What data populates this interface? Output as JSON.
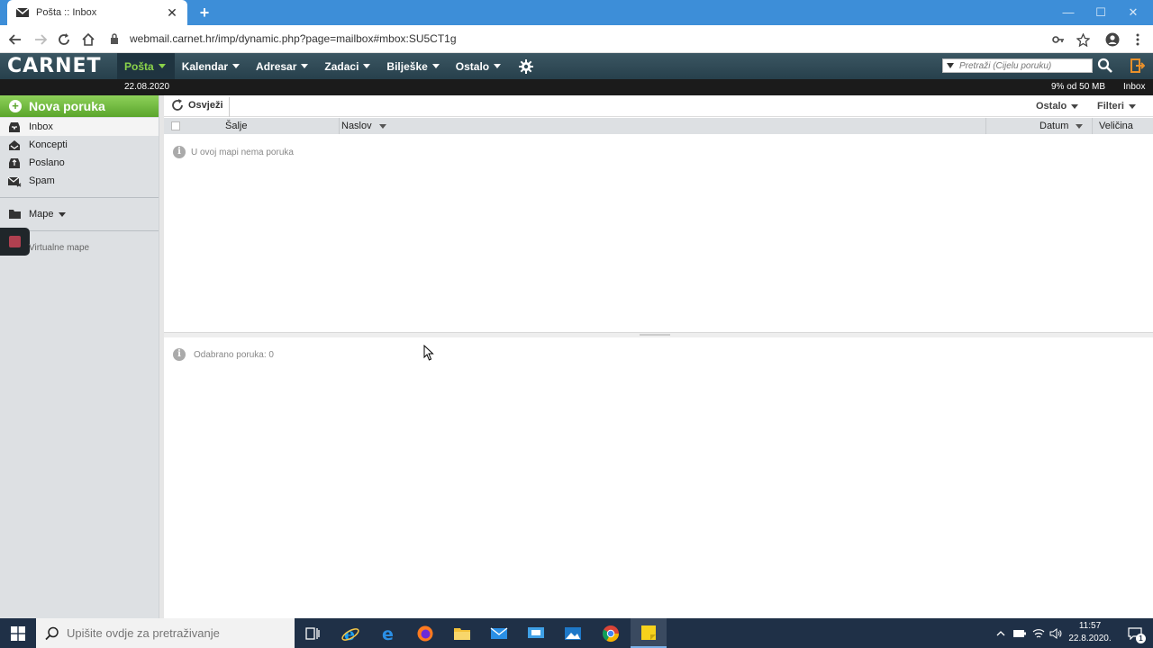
{
  "browser": {
    "tab_title": "Pošta :: Inbox",
    "new_tab": "+",
    "url": "webmail.carnet.hr/imp/dynamic.php?page=mailbox#mbox:SU5CT1g"
  },
  "app": {
    "logo": "CARNET",
    "menu": [
      {
        "label": "Pošta"
      },
      {
        "label": "Kalendar"
      },
      {
        "label": "Adresar"
      },
      {
        "label": "Zadaci"
      },
      {
        "label": "Bilješke"
      },
      {
        "label": "Ostalo"
      }
    ],
    "search_placeholder": "Pretraži (Cijelu poruku)",
    "date": "22.08.2020",
    "quota": "9% od 50 MB",
    "current_mailbox": "Inbox",
    "accent_color": "#8bd34a"
  },
  "sidebar": {
    "compose_label": "Nova poruka",
    "folders": [
      {
        "label": "Inbox",
        "icon": "inbox-icon"
      },
      {
        "label": "Koncepti",
        "icon": "drafts-icon"
      },
      {
        "label": "Poslano",
        "icon": "sent-icon"
      },
      {
        "label": "Spam",
        "icon": "spam-icon"
      }
    ],
    "mape_label": "Mape",
    "virtual_label": "Virtualne mape"
  },
  "list": {
    "refresh_label": "Osvježi",
    "ostalo_label": "Ostalo",
    "filteri_label": "Filteri",
    "columns": {
      "from": "Šalje",
      "subject": "Naslov",
      "date": "Datum",
      "size": "Veličina"
    },
    "empty_message": "U ovoj mapi nema poruka",
    "selected_message": "Odabrano poruka: 0"
  },
  "taskbar": {
    "search_placeholder": "Upišite ovdje za pretraživanje",
    "time": "11:57",
    "date": "22.8.2020.",
    "notification_count": "1"
  }
}
